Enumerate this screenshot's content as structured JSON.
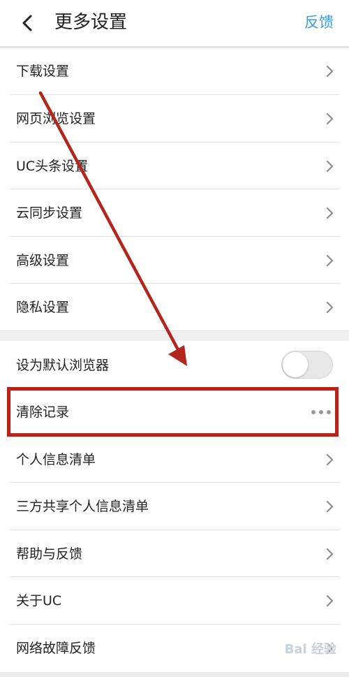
{
  "header": {
    "title": "更多设置",
    "feedback_label": "反馈",
    "back_icon": "chevron-left-icon"
  },
  "group1": [
    {
      "label": "下载设置",
      "accessory": "chevron-right-icon"
    },
    {
      "label": "网页浏览设置",
      "accessory": "chevron-right-icon"
    },
    {
      "label": "UC头条设置",
      "accessory": "chevron-right-icon"
    },
    {
      "label": "云同步设置",
      "accessory": "chevron-right-icon"
    },
    {
      "label": "高级设置",
      "accessory": "chevron-right-icon"
    },
    {
      "label": "隐私设置",
      "accessory": "chevron-right-icon"
    }
  ],
  "group2": [
    {
      "label": "设为默认浏览器",
      "accessory": "toggle",
      "toggle_on": false
    },
    {
      "label": "清除记录",
      "accessory": "more-dots-icon"
    },
    {
      "label": "个人信息清单",
      "accessory": "chevron-right-icon"
    },
    {
      "label": "三方共享个人信息清单",
      "accessory": "chevron-right-icon"
    },
    {
      "label": "帮助与反馈",
      "accessory": "chevron-right-icon"
    },
    {
      "label": "关于UC",
      "accessory": "chevron-right-icon"
    },
    {
      "label": "网络故障反馈",
      "accessory": "chevron-right-icon"
    }
  ],
  "colors": {
    "accent": "#3a9be0",
    "annotation_red": "#b3261e"
  },
  "watermark": {
    "text": "Bai 经验"
  }
}
